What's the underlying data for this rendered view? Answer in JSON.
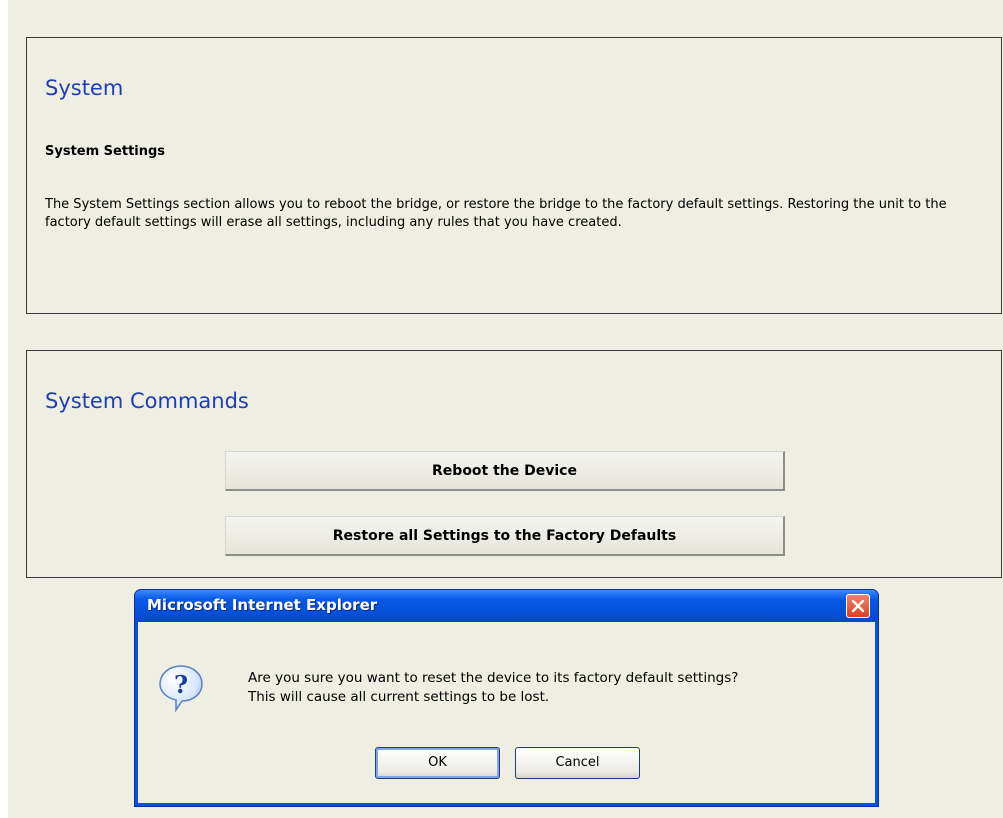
{
  "system": {
    "title": "System",
    "subtitle": "System Settings",
    "description": "The System Settings section allows you to reboot the bridge, or restore the bridge to the factory default settings. Restoring the unit to the factory default settings will erase all settings, including any rules that you have created."
  },
  "commands": {
    "title": "System Commands",
    "reboot_label": "Reboot the Device",
    "restore_label": "Restore all Settings to the Factory Defaults"
  },
  "dialog": {
    "title": "Microsoft Internet Explorer",
    "message_line1": "Are you sure you want to reset the device to its factory default settings?",
    "message_line2": "This will cause all current settings to be lost.",
    "ok_label": "OK",
    "cancel_label": "Cancel",
    "icon": "question-icon"
  },
  "colors": {
    "heading": "#1e3fb4",
    "page_bg": "#efeee3",
    "titlebar": "#0858e6",
    "close": "#d8411f"
  }
}
